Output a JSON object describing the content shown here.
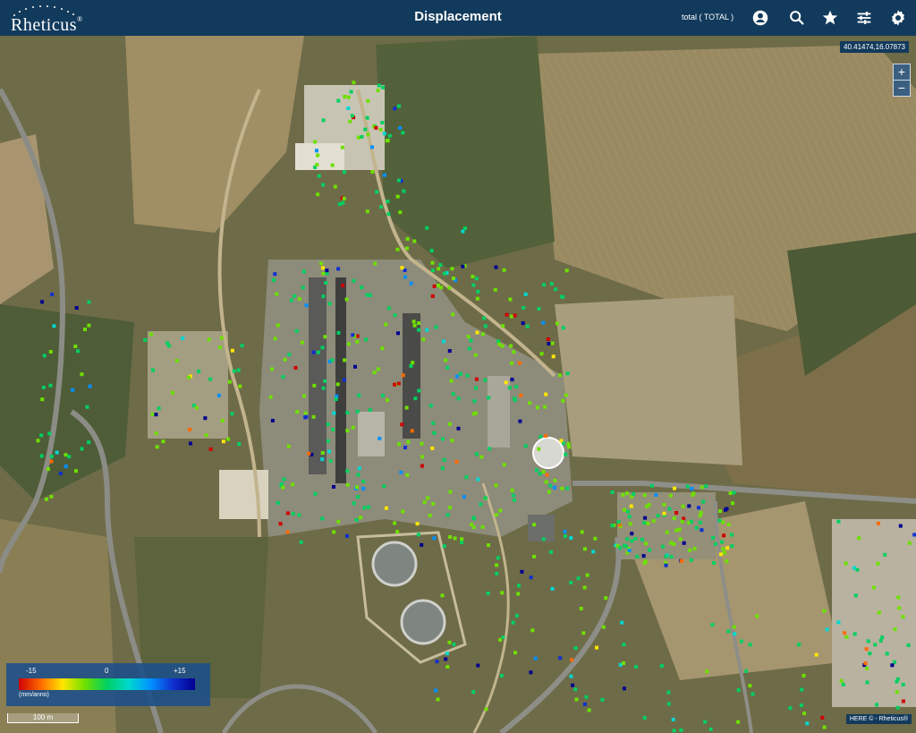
{
  "header": {
    "logo_text": "Rheticus",
    "title": "Displacement",
    "layer_selector": "total ( TOTAL )",
    "icons": [
      "user-icon",
      "search-icon",
      "star-icon",
      "filter-sliders-icon",
      "gear-icon"
    ]
  },
  "map": {
    "coordinates": "40.41474,16.07873",
    "zoom_in_label": "+",
    "zoom_out_label": "−",
    "attribution": "HERE © - Rheticus®",
    "scale_label": "100 m"
  },
  "legend": {
    "min_label": "-15",
    "mid_label": "0",
    "max_label": "+15",
    "unit": "(mm/anno)",
    "colors": [
      "#d00000",
      "#ff6a00",
      "#ffe600",
      "#6ee000",
      "#00d060",
      "#00d8d0",
      "#0090ff",
      "#1030d0",
      "#000090"
    ]
  },
  "colors": {
    "topbar": "#123a5c",
    "legend_bg": "#1b4e8a"
  }
}
